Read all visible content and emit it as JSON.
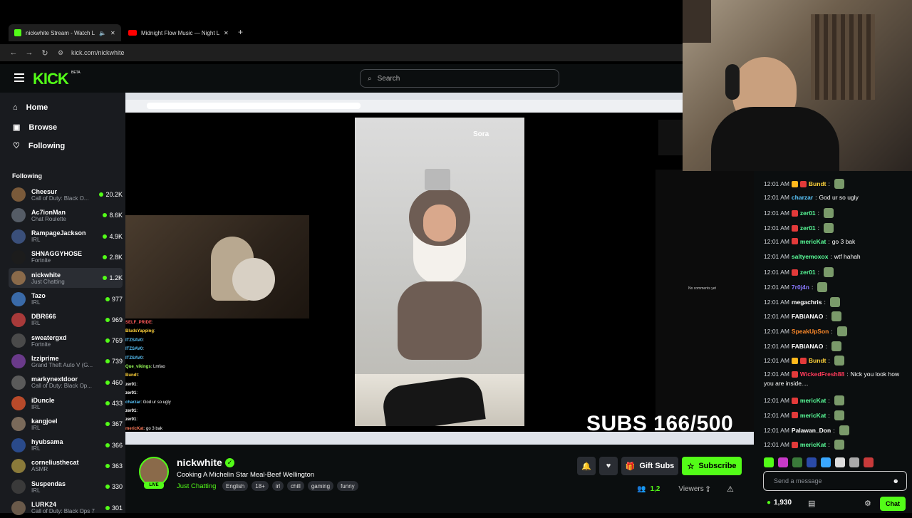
{
  "browser": {
    "tabs": [
      {
        "title": "nickwhite Stream - Watch L",
        "favicon": "kick-icon"
      },
      {
        "title": "Midnight Flow Music — Night L",
        "favicon": "youtube-icon"
      }
    ],
    "url": "kick.com/nickwhite"
  },
  "header": {
    "logo": "KICK",
    "beta": "BETA",
    "search_placeholder": "Search"
  },
  "sidebar": {
    "nav": [
      {
        "label": "Home",
        "icon": "home-icon"
      },
      {
        "label": "Browse",
        "icon": "browse-icon"
      },
      {
        "label": "Following",
        "icon": "heart-icon"
      }
    ],
    "following_title": "Following",
    "channels": [
      {
        "name": "Cheesur",
        "category": "Call of Duty: Black O...",
        "viewers": "20.2K",
        "color": "#7a5a3a"
      },
      {
        "name": "Ac7ionMan",
        "category": "Chat Roulette",
        "viewers": "8.6K",
        "color": "#555c66"
      },
      {
        "name": "RampageJackson",
        "category": "IRL",
        "viewers": "4.9K",
        "color": "#3a4f7a"
      },
      {
        "name": "SHNAGGYHOSE",
        "category": "Fortnite",
        "viewers": "2.8K",
        "color": "#1c1c1c"
      },
      {
        "name": "nickwhite",
        "category": "Just Chatting",
        "viewers": "1.2K",
        "color": "#8a6a4a",
        "selected": true
      },
      {
        "name": "Tazo",
        "category": "IRL",
        "viewers": "977",
        "color": "#3a6aa8"
      },
      {
        "name": "DBR666",
        "category": "IRL",
        "viewers": "969",
        "color": "#a83a3a"
      },
      {
        "name": "sweatergxd",
        "category": "Fortnite",
        "viewers": "769",
        "color": "#4a4a4a"
      },
      {
        "name": "Izziprime",
        "category": "Grand Theft Auto V (G...",
        "viewers": "739",
        "color": "#6a3a8a"
      },
      {
        "name": "markynextdoor",
        "category": "Call of Duty: Black Op...",
        "viewers": "460",
        "color": "#5a5a5a"
      },
      {
        "name": "iDuncle",
        "category": "IRL",
        "viewers": "433",
        "color": "#b84a2a"
      },
      {
        "name": "kangjoel",
        "category": "IRL",
        "viewers": "367",
        "color": "#7a6a5a"
      },
      {
        "name": "hyubsama",
        "category": "IRL",
        "viewers": "366",
        "color": "#2a4a8a"
      },
      {
        "name": "corneliusthecat",
        "category": "ASMR",
        "viewers": "363",
        "color": "#8a7a3a"
      },
      {
        "name": "Suspendas",
        "category": "IRL",
        "viewers": "330",
        "color": "#3a3a3a"
      },
      {
        "name": "LURK24",
        "category": "Call of Duty: Black Ops 7",
        "viewers": "301",
        "color": "#6a5a4a"
      }
    ]
  },
  "player": {
    "overlay_brand": "Sora",
    "overlay_comment": "No comments yet",
    "subs_goal": "SUBS 166/500",
    "overlay_chat": [
      {
        "user": "SELF_PRIDE",
        "text": "",
        "color": "#ff5a5a"
      },
      {
        "user": "BludsYapping",
        "text": "",
        "color": "#ffd23a"
      },
      {
        "user": "ITZSAV0",
        "text": "",
        "color": "#5ac8ff"
      },
      {
        "user": "ITZSAV0",
        "text": "",
        "color": "#5ac8ff"
      },
      {
        "user": "ITZSAV0",
        "text": "",
        "color": "#5ac8ff"
      },
      {
        "user": "Que_vikings",
        "text": "Lmfao",
        "color": "#9aff5a"
      },
      {
        "user": "Bundt",
        "text": "",
        "color": "#ffd23a"
      },
      {
        "user": "zer01",
        "text": "",
        "color": "#ffffff"
      },
      {
        "user": "zer01",
        "text": "",
        "color": "#ffffff"
      },
      {
        "user": "charzar",
        "text": "God ur so ugly",
        "color": "#5ac8ff"
      },
      {
        "user": "zer01",
        "text": "",
        "color": "#ffffff"
      },
      {
        "user": "zer01",
        "text": "",
        "color": "#ffffff"
      },
      {
        "user": "mericKat",
        "text": "go 3 bak",
        "color": "#ff7a5a"
      },
      {
        "user": "saltyemoxox",
        "text": "wtf hahah",
        "color": "#9aff5a"
      }
    ]
  },
  "stream": {
    "channel": "nickwhite",
    "live": "LIVE",
    "title": "Cooking A Michelin Star Meal-Beef Wellington",
    "category": "Just Chatting",
    "tags": [
      "English",
      "18+",
      "irl",
      "chill",
      "gaming",
      "funny"
    ],
    "gift_label": "Gift Subs",
    "subscribe_label": "Subscribe",
    "viewer_count": "1,2",
    "viewers_label": "Viewers"
  },
  "chat": {
    "messages": [
      {
        "time": "12:01 AM",
        "user": "Bundt",
        "text": "",
        "color": "#ffd23a",
        "badges": 2,
        "emote": true
      },
      {
        "time": "12:01 AM",
        "user": "charzar",
        "text": "God ur so ugly",
        "color": "#5ac8ff",
        "badges": 0,
        "emote": false
      },
      {
        "time": "12:01 AM",
        "user": "zer01",
        "text": "",
        "color": "#5aff9a",
        "badges": 1,
        "emote": true
      },
      {
        "time": "12:01 AM",
        "user": "zer01",
        "text": "",
        "color": "#5aff9a",
        "badges": 1,
        "emote": true
      },
      {
        "time": "12:01 AM",
        "user": "mericKat",
        "text": "go 3 bak",
        "color": "#5aff9a",
        "badges": 1,
        "emote": false
      },
      {
        "time": "12:01 AM",
        "user": "saltyemoxox",
        "text": "wtf hahah",
        "color": "#5aff9a",
        "badges": 0,
        "emote": false
      },
      {
        "time": "12:01 AM",
        "user": "zer01",
        "text": "",
        "color": "#5aff9a",
        "badges": 1,
        "emote": true
      },
      {
        "time": "12:01 AM",
        "user": "7r0j4n",
        "text": "",
        "color": "#8a7aff",
        "badges": 0,
        "emote": true
      },
      {
        "time": "12:01 AM",
        "user": "megachris",
        "text": "",
        "color": "#ffffff",
        "badges": 0,
        "emote": true
      },
      {
        "time": "12:01 AM",
        "user": "FABIANAO",
        "text": "",
        "color": "#ffffff",
        "badges": 0,
        "emote": true
      },
      {
        "time": "12:01 AM",
        "user": "SpeakUpSon",
        "text": "",
        "color": "#ff8a2a",
        "badges": 0,
        "emote": true
      },
      {
        "time": "12:01 AM",
        "user": "FABIANAO",
        "text": "",
        "color": "#ffffff",
        "badges": 0,
        "emote": true
      },
      {
        "time": "12:01 AM",
        "user": "Bundt",
        "text": "",
        "color": "#ffd23a",
        "badges": 2,
        "emote": true
      },
      {
        "time": "12:01 AM",
        "user": "WickedFresh88",
        "text": "Nick you look how",
        "text2": "you are inside....",
        "color": "#ff3a5a",
        "badges": 1,
        "emote": false
      },
      {
        "time": "12:01 AM",
        "user": "mericKat",
        "text": "",
        "color": "#5aff9a",
        "badges": 1,
        "emote": true
      },
      {
        "time": "12:01 AM",
        "user": "mericKat",
        "text": "",
        "color": "#5aff9a",
        "badges": 1,
        "emote": true
      },
      {
        "time": "12:01 AM",
        "user": "Palawan_Don",
        "text": "",
        "color": "#ffffff",
        "badges": 0,
        "emote": true
      },
      {
        "time": "12:01 AM",
        "user": "mericKat",
        "text": "",
        "color": "#5aff9a",
        "badges": 1,
        "emote": true
      }
    ],
    "input_placeholder": "Send a message",
    "points": "1,930",
    "chat_button": "Chat"
  },
  "colors": {
    "accent": "#53fc18",
    "bg": "#0b0e0f",
    "sidebar": "#191b1f"
  }
}
